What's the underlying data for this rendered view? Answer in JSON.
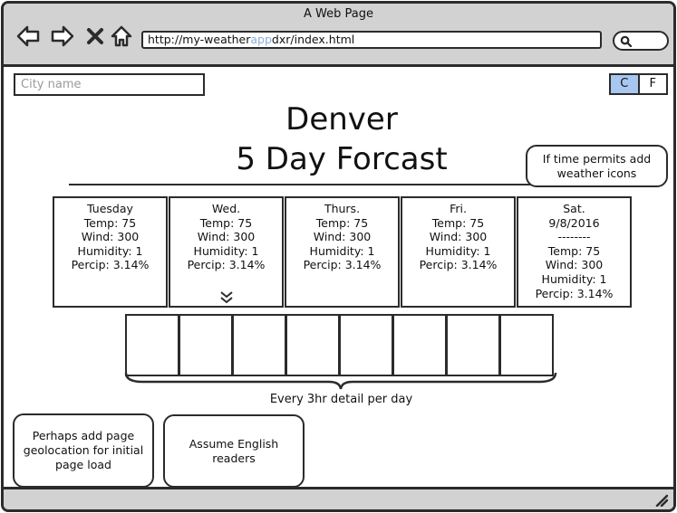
{
  "window": {
    "title": "A Web Page"
  },
  "browser": {
    "url_prefix": "http://my-weather",
    "url_highlight": "app",
    "url_suffix": "dxr/index.html"
  },
  "search": {
    "placeholder": "City name"
  },
  "units": {
    "celsius": "C",
    "fahrenheit": "F",
    "active": "C"
  },
  "heading": {
    "city": "Denver",
    "subtitle": "5 Day Forcast"
  },
  "notes": {
    "weather_icons": [
      "If time permits add",
      "weather icons"
    ],
    "geolocation": [
      "Perhaps add page",
      "geolocation for initial",
      "page load"
    ],
    "english": [
      "Assume English",
      "readers"
    ]
  },
  "days": [
    {
      "name": "Tuesday",
      "temp": "Temp: 75",
      "wind": "Wind: 300",
      "humidity": "Humidity: 1",
      "precip": "Percip: 3.14%"
    },
    {
      "name": "Wed.",
      "temp": "Temp: 75",
      "wind": "Wind: 300",
      "humidity": "Humidity: 1",
      "precip": "Percip: 3.14%"
    },
    {
      "name": "Thurs.",
      "temp": "Temp: 75",
      "wind": "Wind: 300",
      "humidity": "Humidity: 1",
      "precip": "Percip: 3.14%"
    },
    {
      "name": "Fri.",
      "temp": "Temp: 75",
      "wind": "Wind: 300",
      "humidity": "Humidity: 1",
      "precip": "Percip: 3.14%"
    },
    {
      "name": "Sat.",
      "date": "9/8/2016",
      "divider": "--------",
      "temp": "Temp: 75",
      "wind": "Wind: 300",
      "humidity": "Humidity: 1",
      "precip": "Percip: 3.14%"
    }
  ],
  "hourly": {
    "caption": "Every 3hr detail per day",
    "count": 8
  },
  "colors": {
    "chrome": "#d2d2d2",
    "active_toggle": "#a7c6f0",
    "url_highlight": "#8aaee0",
    "stroke": "#2b2b2b"
  },
  "icons": [
    "back-arrow-icon",
    "forward-arrow-icon",
    "close-icon",
    "home-icon",
    "search-icon",
    "double-chevron-down-icon",
    "resize-grip-icon"
  ]
}
